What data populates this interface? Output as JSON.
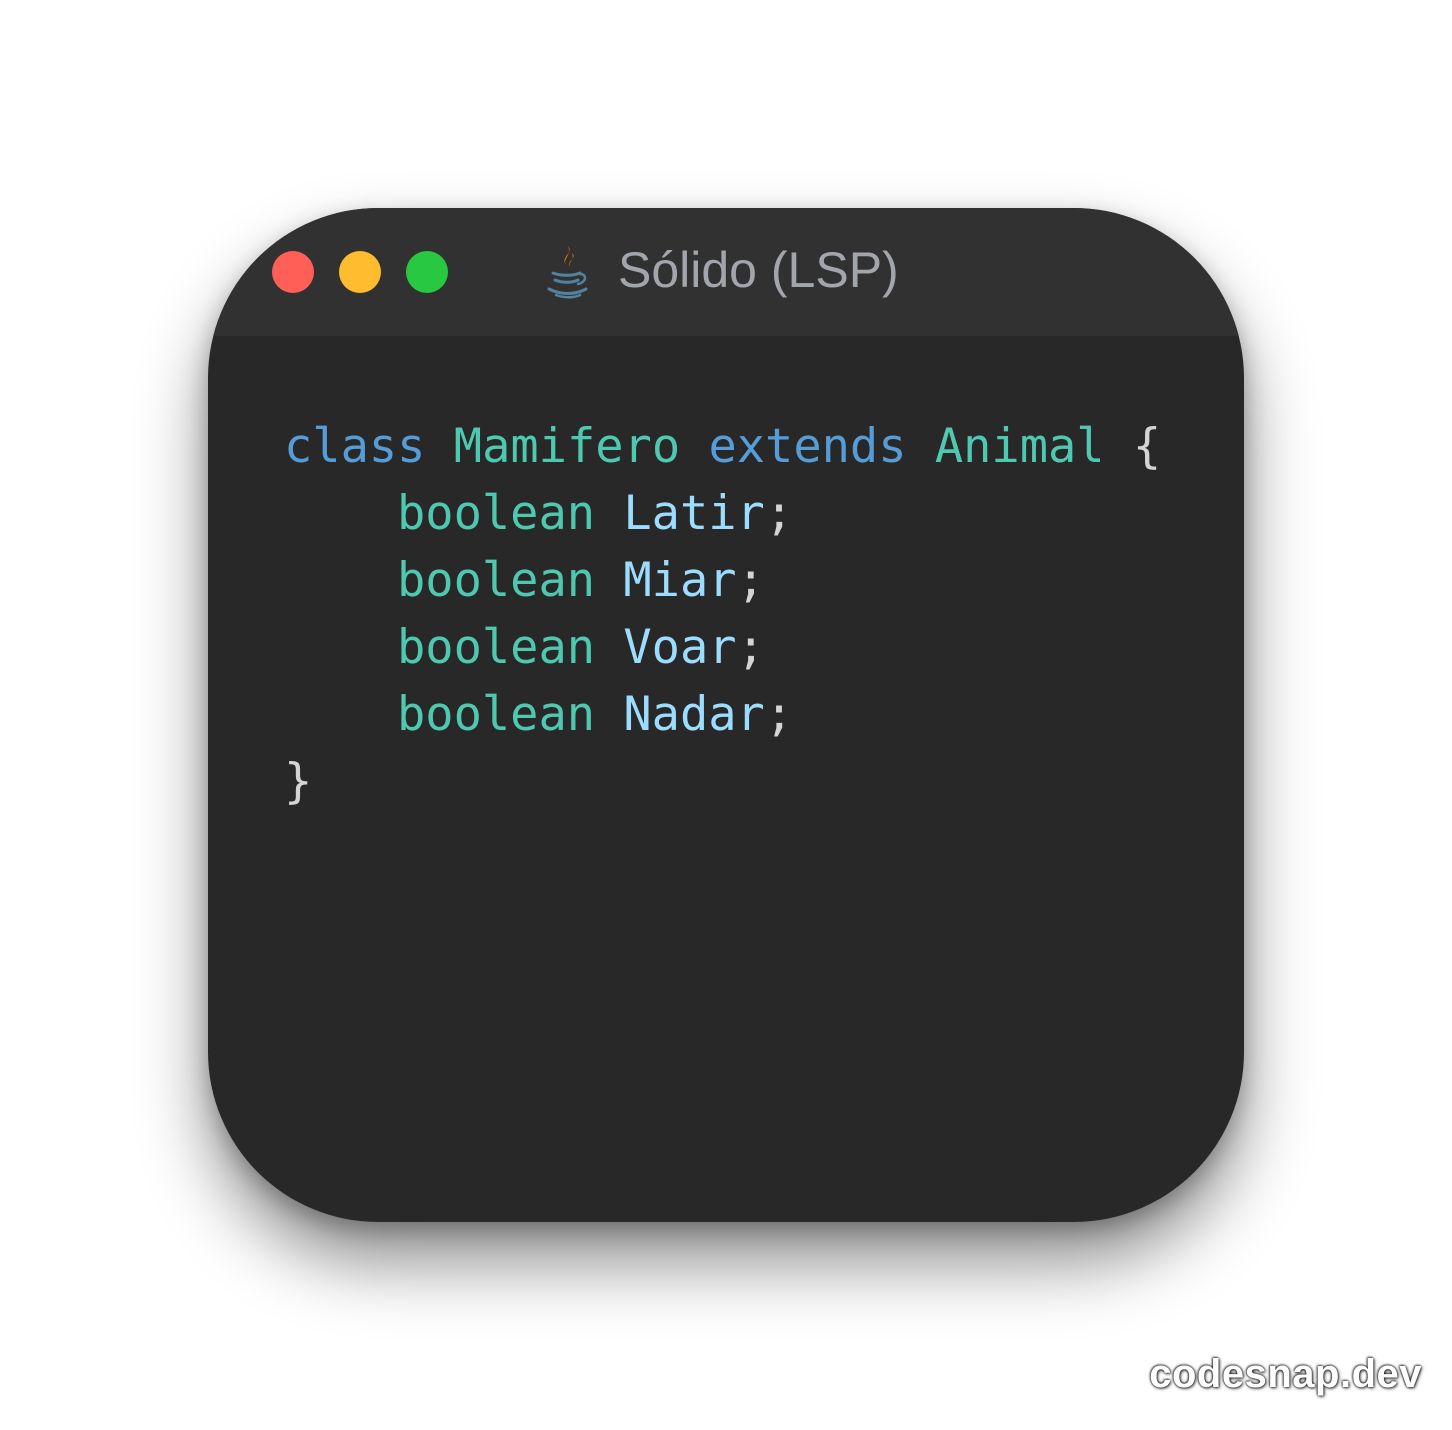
{
  "colors": {
    "page_background": "#ffffff",
    "window_background": "#282828",
    "titlebar_background": "#313131",
    "close_button": "#ff5f57",
    "minimize_button": "#febc2e",
    "zoom_button": "#28c840",
    "title_text": "#a2a5ab",
    "keyword": "#569cd6",
    "type": "#4ec9b0",
    "identifier": "#9cdcfe",
    "punctuation": "#d4d4d4"
  },
  "window": {
    "title": "Sólido (LSP)",
    "file_icon": "java-icon",
    "controls": [
      "close",
      "minimize",
      "zoom"
    ]
  },
  "code": {
    "language": "java",
    "line1": {
      "keyword_class": "class",
      "class_name": "Mamifero",
      "keyword_extends": "extends",
      "parent_name": "Animal",
      "open_brace": "{"
    },
    "fields": [
      {
        "type": "boolean",
        "name": "Latir",
        "semicolon": ";"
      },
      {
        "type": "boolean",
        "name": "Miar",
        "semicolon": ";"
      },
      {
        "type": "boolean",
        "name": "Voar",
        "semicolon": ";"
      },
      {
        "type": "boolean",
        "name": "Nadar",
        "semicolon": ";"
      }
    ],
    "close_brace": "}"
  },
  "watermark": "codesnap.dev"
}
